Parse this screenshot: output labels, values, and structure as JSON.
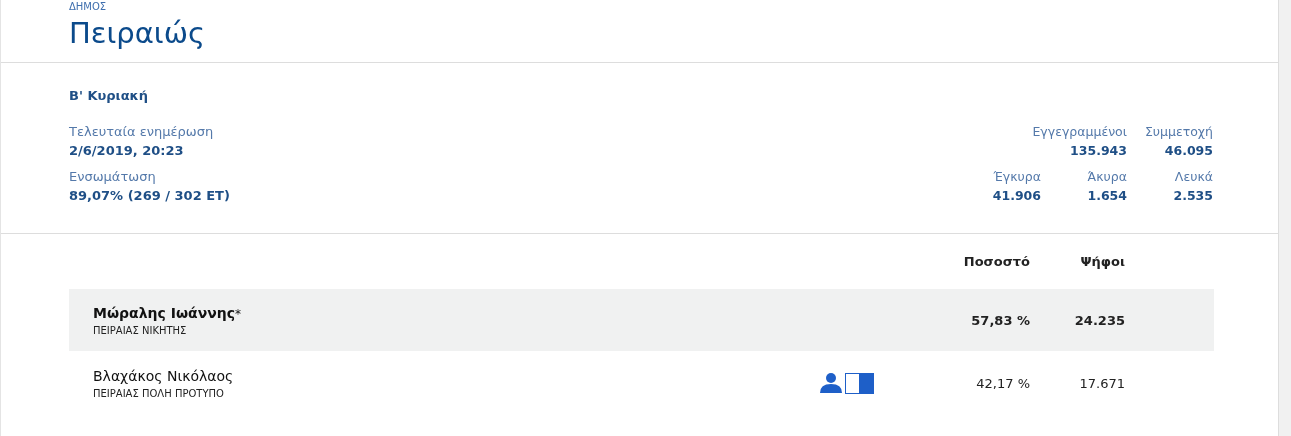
{
  "header": {
    "kicker": "ΔΗΜΟΣ",
    "title": "Πειραιώς"
  },
  "round": "Β' Κυριακή",
  "info": [
    {
      "label": "Τελευταία ενημέρωση",
      "value": "2/6/2019, 20:23"
    },
    {
      "label": "Ενσωμάτωση",
      "value": "89,07% (269 / 302 ΕΤ)"
    }
  ],
  "stats": [
    [
      {
        "label": "Εγγεγραμμένοι",
        "value": "135.943"
      },
      {
        "label": "Συμμετοχή",
        "value": "46.095"
      }
    ],
    [
      {
        "label": "Έγκυρα",
        "value": "41.906"
      },
      {
        "label": "Άκυρα",
        "value": "1.654"
      },
      {
        "label": "Λευκά",
        "value": "2.535"
      }
    ]
  ],
  "table": {
    "columns": [
      "Ποσοστό",
      "Ψήφοι"
    ],
    "rows": [
      {
        "name": "Μώραλης Ιωάννης",
        "mark": "*",
        "party": "ΠΕΙΡΑΙΑΣ ΝΙΚΗΤΗΣ",
        "percent": "57,83 %",
        "votes": "24.235",
        "winner": true,
        "icons": false
      },
      {
        "name": "Βλαχάκος Νικόλαος",
        "party": "ΠΕΙΡΑΙΑΣ ΠΟΛΗ ΠΡΟΤΥΠΟ",
        "percent": "42,17 %",
        "votes": "17.671",
        "winner": false,
        "icons": true
      }
    ]
  }
}
